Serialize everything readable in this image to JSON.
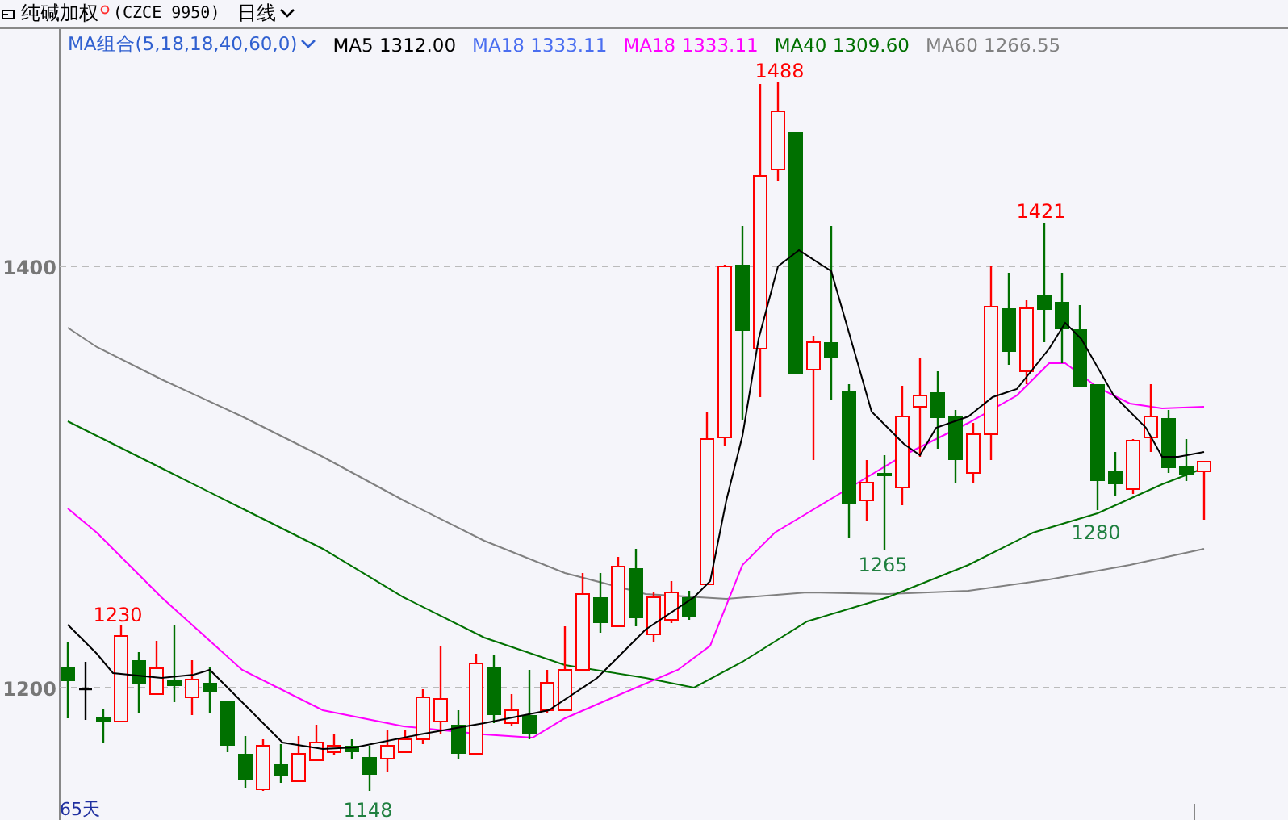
{
  "header": {
    "title": "纯碱加权",
    "code": "(CZCE 9950)",
    "period": "日线"
  },
  "legend": {
    "group": "MA组合(5,18,18,40,60,0)",
    "items": [
      {
        "label": "MA5 1312.00",
        "color": "#000000"
      },
      {
        "label": "MA18 1333.11",
        "color": "#4a6ef0"
      },
      {
        "label": "MA18 1333.11",
        "color": "#ff00ff"
      },
      {
        "label": "MA40 1309.60",
        "color": "#007000"
      },
      {
        "label": "MA60 1266.55",
        "color": "#808080"
      }
    ]
  },
  "y_axis": {
    "ticks": [
      "1400",
      "1200"
    ]
  },
  "annotations": [
    {
      "label": "1488",
      "kind": "high"
    },
    {
      "label": "1421",
      "kind": "high"
    },
    {
      "label": "1265",
      "kind": "low"
    },
    {
      "label": "1280",
      "kind": "low"
    },
    {
      "label": "1230",
      "kind": "high"
    },
    {
      "label": "1148",
      "kind": "low"
    }
  ],
  "period_count": "65天"
}
